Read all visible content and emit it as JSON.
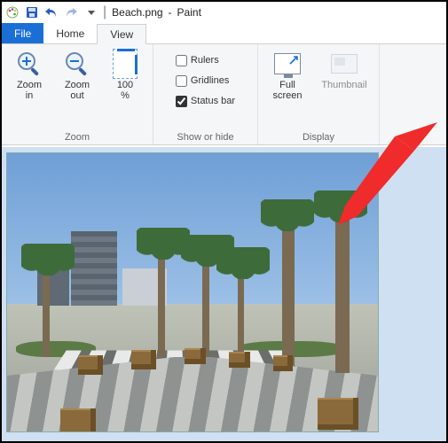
{
  "title": {
    "filename": "Beach.png",
    "app": "Paint",
    "separator": "-"
  },
  "qat": {
    "dropdown_icon": "chevron-down"
  },
  "menu": {
    "file": "File",
    "home": "Home",
    "view": "View",
    "active": "view"
  },
  "ribbon": {
    "zoom": {
      "zoom_in": "Zoom\nin",
      "zoom_out": "Zoom\nout",
      "hundred": "100\n%",
      "group_label": "Zoom"
    },
    "show": {
      "rulers": "Rulers",
      "rulers_checked": false,
      "gridlines": "Gridlines",
      "gridlines_checked": false,
      "statusbar": "Status bar",
      "statusbar_checked": true,
      "group_label": "Show or hide"
    },
    "display": {
      "full_screen": "Full\nscreen",
      "thumbnail": "Thumbnail",
      "group_label": "Display"
    }
  },
  "colors": {
    "file_tab": "#1a6fd6",
    "arrow": "#ef2b2b"
  }
}
